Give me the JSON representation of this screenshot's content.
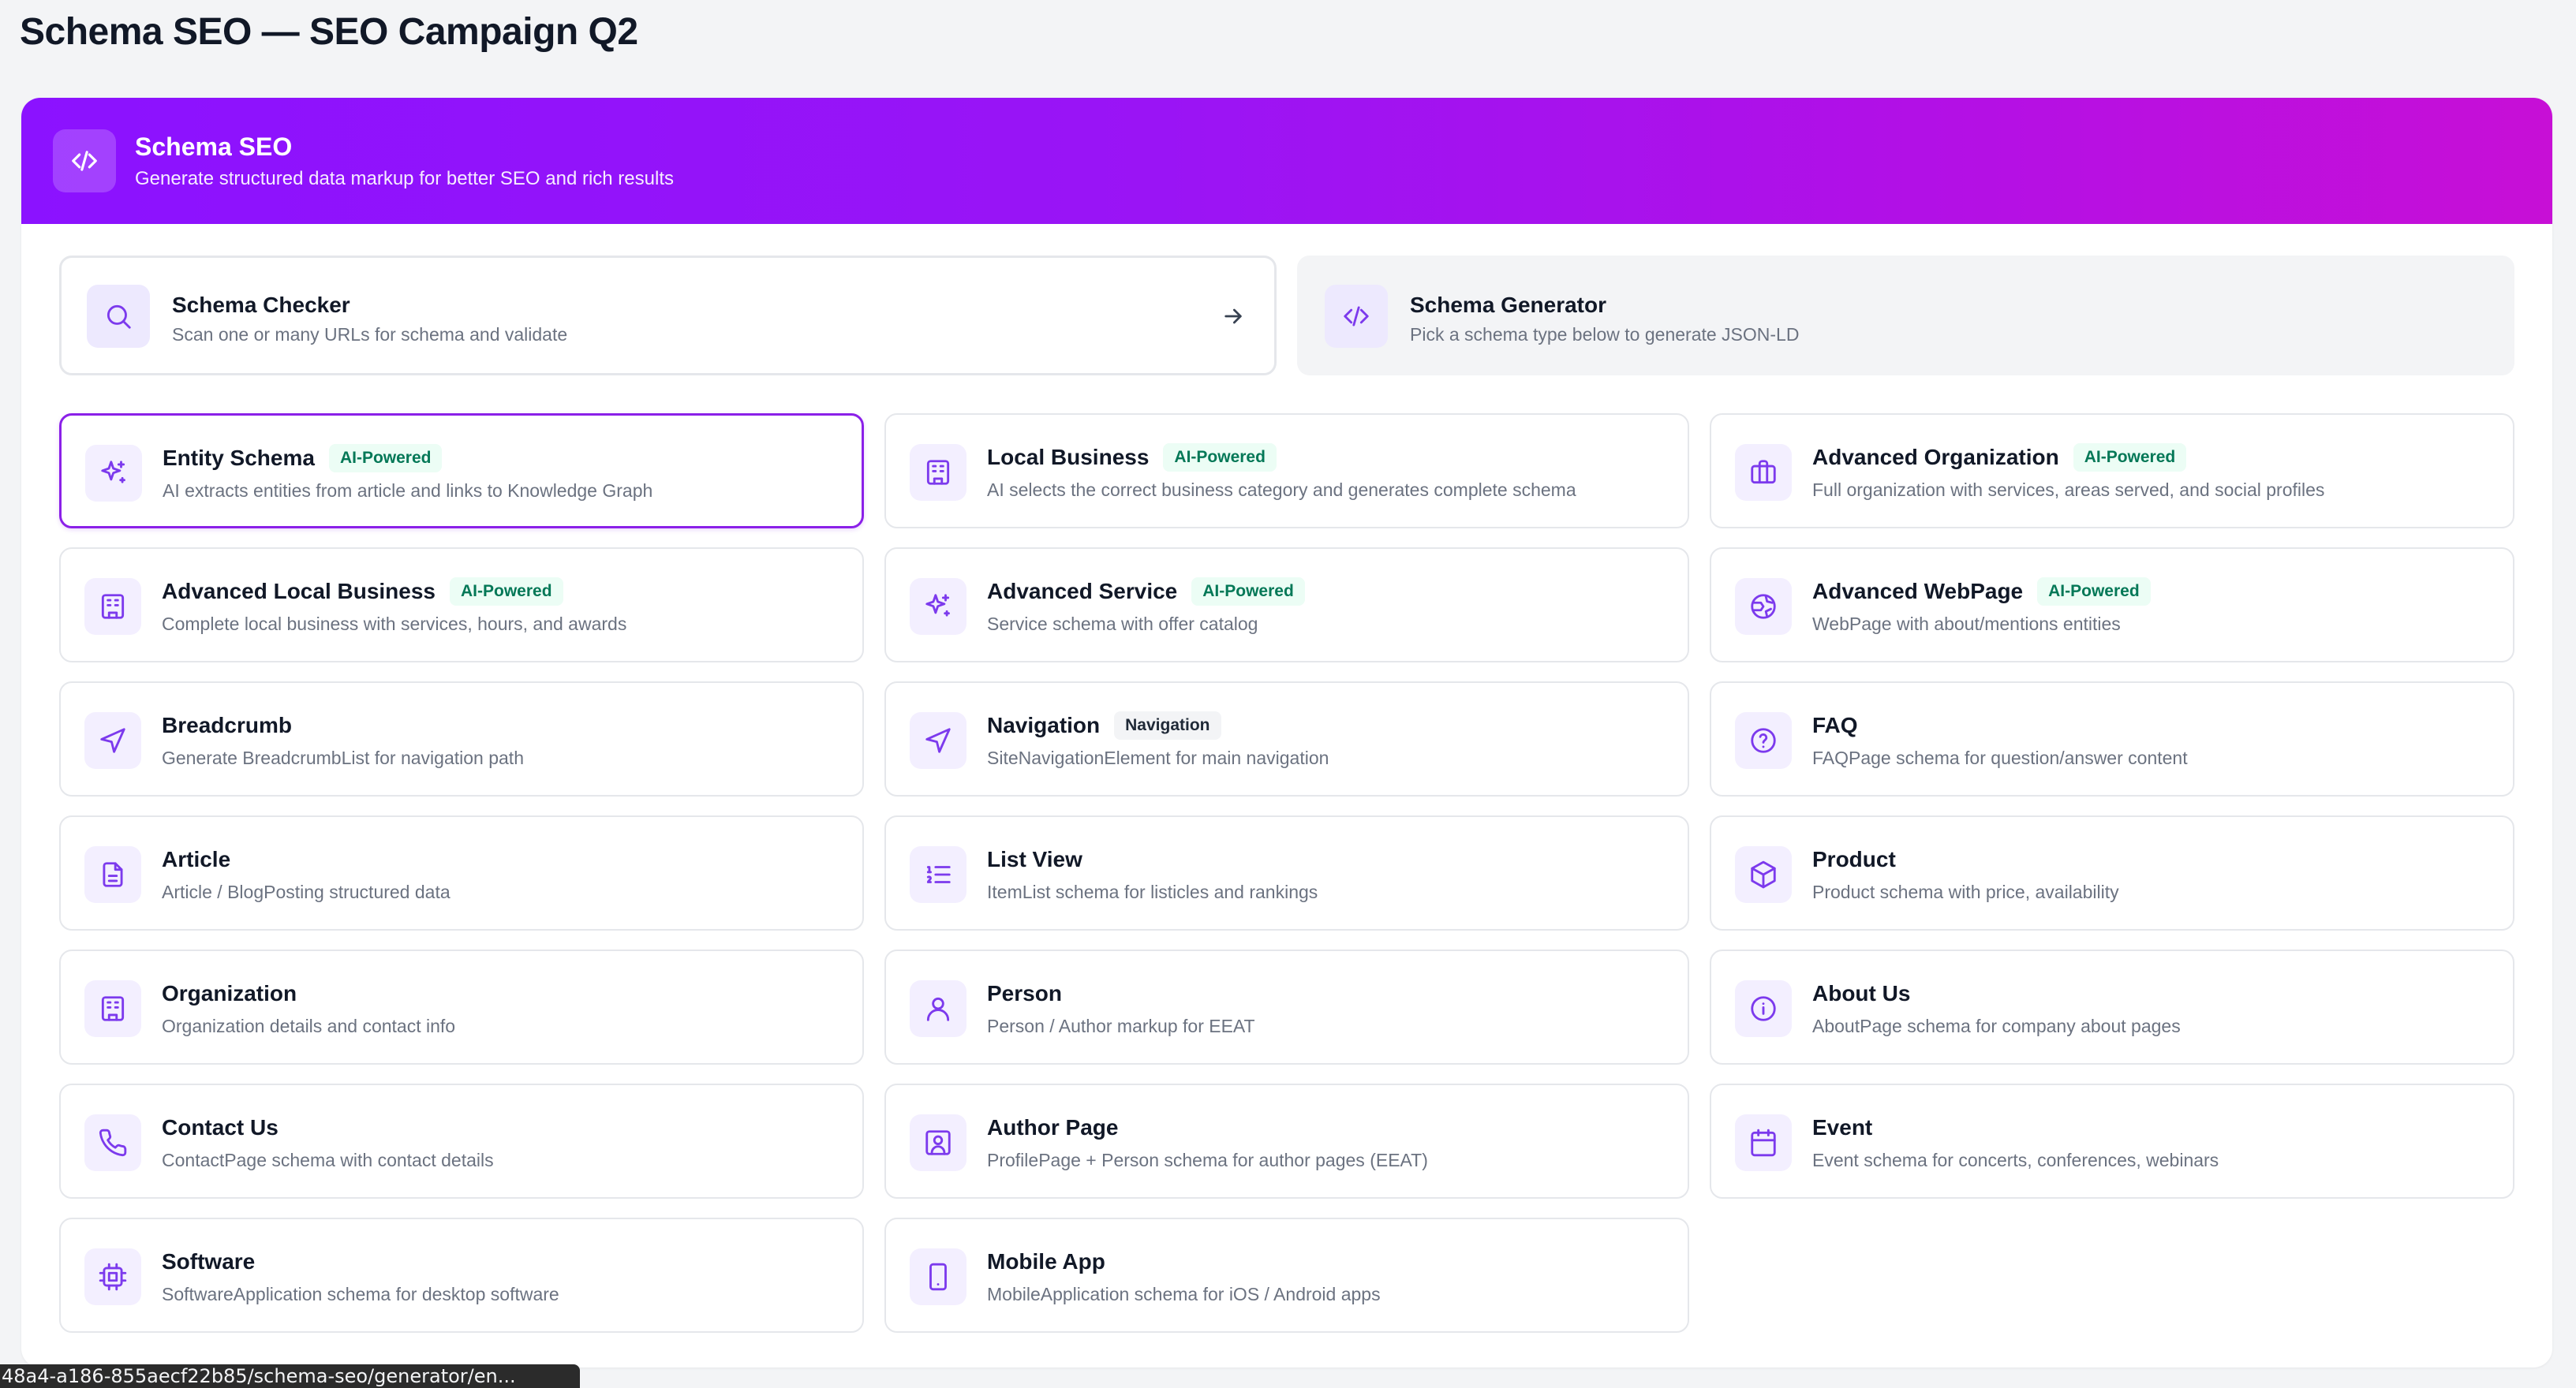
{
  "page": {
    "title": "Schema SEO — SEO Campaign Q2"
  },
  "banner": {
    "title": "Schema SEO",
    "subtitle": "Generate structured data markup for better SEO and rich results",
    "icon": "code-icon"
  },
  "tools": [
    {
      "title": "Schema Checker",
      "subtitle": "Scan one or many URLs for schema and validate",
      "icon": "search-icon"
    },
    {
      "title": "Schema Generator",
      "subtitle": "Pick a schema type below to generate JSON-LD",
      "icon": "code-icon"
    }
  ],
  "schema_types": [
    {
      "title": "Entity Schema",
      "badge": "AI-Powered",
      "subtitle": "AI extracts entities from article and links to Knowledge Graph",
      "icon": "sparkles-icon",
      "selected": true
    },
    {
      "title": "Local Business",
      "badge": "AI-Powered",
      "subtitle": "AI selects the correct business category and generates complete schema",
      "icon": "building-icon"
    },
    {
      "title": "Advanced Organization",
      "badge": "AI-Powered",
      "subtitle": "Full organization with services, areas served, and social profiles",
      "icon": "briefcase-icon"
    },
    {
      "title": "Advanced Local Business",
      "badge": "AI-Powered",
      "subtitle": "Complete local business with services, hours, and awards",
      "icon": "building-icon"
    },
    {
      "title": "Advanced Service",
      "badge": "AI-Powered",
      "subtitle": "Service schema with offer catalog",
      "icon": "sparkles-icon"
    },
    {
      "title": "Advanced WebPage",
      "badge": "AI-Powered",
      "subtitle": "WebPage with about/mentions entities",
      "icon": "globe-icon"
    },
    {
      "title": "Breadcrumb",
      "badge": "",
      "subtitle": "Generate BreadcrumbList for navigation path",
      "icon": "navigation-icon"
    },
    {
      "title": "Navigation",
      "badge": "Navigation",
      "subtitle": "SiteNavigationElement for main navigation",
      "icon": "navigation-icon"
    },
    {
      "title": "FAQ",
      "badge": "",
      "subtitle": "FAQPage schema for question/answer content",
      "icon": "help-circle-icon"
    },
    {
      "title": "Article",
      "badge": "",
      "subtitle": "Article / BlogPosting structured data",
      "icon": "file-text-icon"
    },
    {
      "title": "List View",
      "badge": "",
      "subtitle": "ItemList schema for listicles and rankings",
      "icon": "list-ordered-icon"
    },
    {
      "title": "Product",
      "badge": "",
      "subtitle": "Product schema with price, availability",
      "icon": "package-icon"
    },
    {
      "title": "Organization",
      "badge": "",
      "subtitle": "Organization details and contact info",
      "icon": "building-icon"
    },
    {
      "title": "Person",
      "badge": "",
      "subtitle": "Person / Author markup for EEAT",
      "icon": "user-icon"
    },
    {
      "title": "About Us",
      "badge": "",
      "subtitle": "AboutPage schema for company about pages",
      "icon": "info-icon"
    },
    {
      "title": "Contact Us",
      "badge": "",
      "subtitle": "ContactPage schema with contact details",
      "icon": "phone-icon"
    },
    {
      "title": "Author Page",
      "badge": "",
      "subtitle": "ProfilePage + Person schema for author pages (EEAT)",
      "icon": "user-square-icon"
    },
    {
      "title": "Event",
      "badge": "",
      "subtitle": "Event schema for concerts, conferences, webinars",
      "icon": "calendar-icon"
    },
    {
      "title": "Software",
      "badge": "",
      "subtitle": "SoftwareApplication schema for desktop software",
      "icon": "cpu-icon"
    },
    {
      "title": "Mobile App",
      "badge": "",
      "subtitle": "MobileApplication schema for iOS / Android apps",
      "icon": "smartphone-icon"
    }
  ],
  "status_bar": {
    "url": "48a4-a186-855aecf22b85/schema-seo/generator/en..."
  },
  "colors": {
    "accent": "#7c3aed",
    "banner_start": "#8b12ff",
    "banner_end": "#c70fd6",
    "ai_badge_text": "#047857",
    "ai_badge_bg": "#ecfdf5"
  }
}
